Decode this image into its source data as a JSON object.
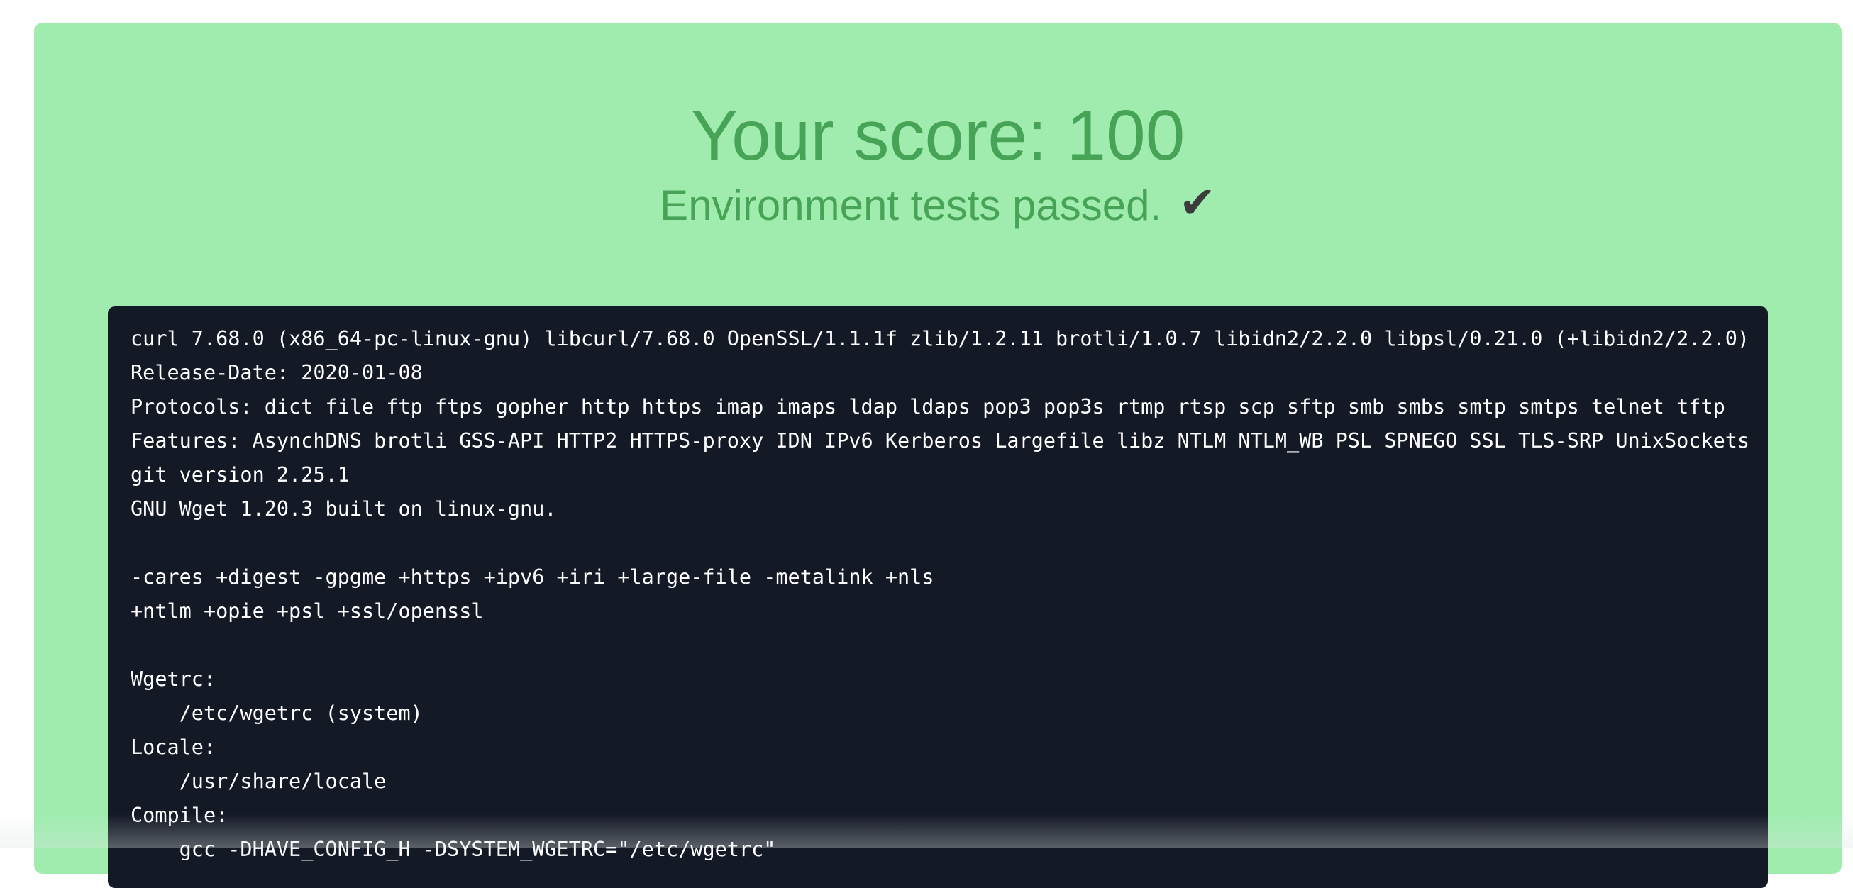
{
  "result": {
    "score_text": "Your score: 100",
    "status_text": "Environment tests passed.",
    "status_icon": "checkmark-icon",
    "check_glyph": "✔",
    "colors": {
      "card_background": "#9fecae",
      "headline": "#47a356",
      "checkmark": "#3c3c3c",
      "terminal_background": "#141926",
      "terminal_text": "#ffffff"
    }
  },
  "terminal": {
    "lines": [
      "curl 7.68.0 (x86_64-pc-linux-gnu) libcurl/7.68.0 OpenSSL/1.1.1f zlib/1.2.11 brotli/1.0.7 libidn2/2.2.0 libpsl/0.21.0 (+libidn2/2.2.0)",
      "Release-Date: 2020-01-08",
      "Protocols: dict file ftp ftps gopher http https imap imaps ldap ldaps pop3 pop3s rtmp rtsp scp sftp smb smbs smtp smtps telnet tftp",
      "Features: AsynchDNS brotli GSS-API HTTP2 HTTPS-proxy IDN IPv6 Kerberos Largefile libz NTLM NTLM_WB PSL SPNEGO SSL TLS-SRP UnixSockets",
      "git version 2.25.1",
      "GNU Wget 1.20.3 built on linux-gnu.",
      "",
      "-cares +digest -gpgme +https +ipv6 +iri +large-file -metalink +nls",
      "+ntlm +opie +psl +ssl/openssl",
      "",
      "Wgetrc:",
      "    /etc/wgetrc (system)",
      "Locale:",
      "    /usr/share/locale",
      "Compile:",
      "    gcc -DHAVE_CONFIG_H -DSYSTEM_WGETRC=\"/etc/wgetrc\""
    ]
  }
}
